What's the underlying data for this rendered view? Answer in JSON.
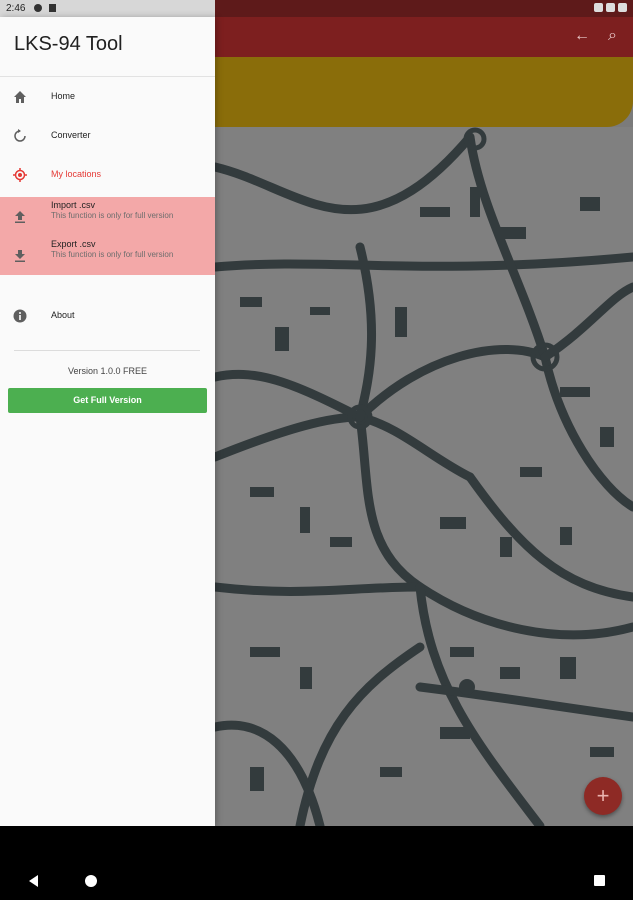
{
  "status": {
    "time": "2:46"
  },
  "drawer": {
    "title": "LKS-94 Tool",
    "items": [
      {
        "label": "Home",
        "icon": "home-icon"
      },
      {
        "label": "Converter",
        "icon": "refresh-icon"
      },
      {
        "label": "My locations",
        "icon": "target-location-icon"
      }
    ],
    "disabled_items": [
      {
        "label": "Import .csv",
        "sub": "This function is only for full version",
        "icon": "upload-icon"
      },
      {
        "label": "Export .csv",
        "sub": "This function is only for full version",
        "icon": "download-icon"
      }
    ],
    "about": {
      "label": "About",
      "icon": "info-icon"
    },
    "version": "Version 1.0.0 FREE",
    "full_version_button": "Get Full Version"
  },
  "colors": {
    "accent": "#e53935",
    "disabled_bg": "#f3a8a8",
    "button_green": "#4caf50",
    "appbar": "#7d1f1f",
    "banner": "#8a6d0a"
  },
  "fab": {
    "label": "+"
  }
}
